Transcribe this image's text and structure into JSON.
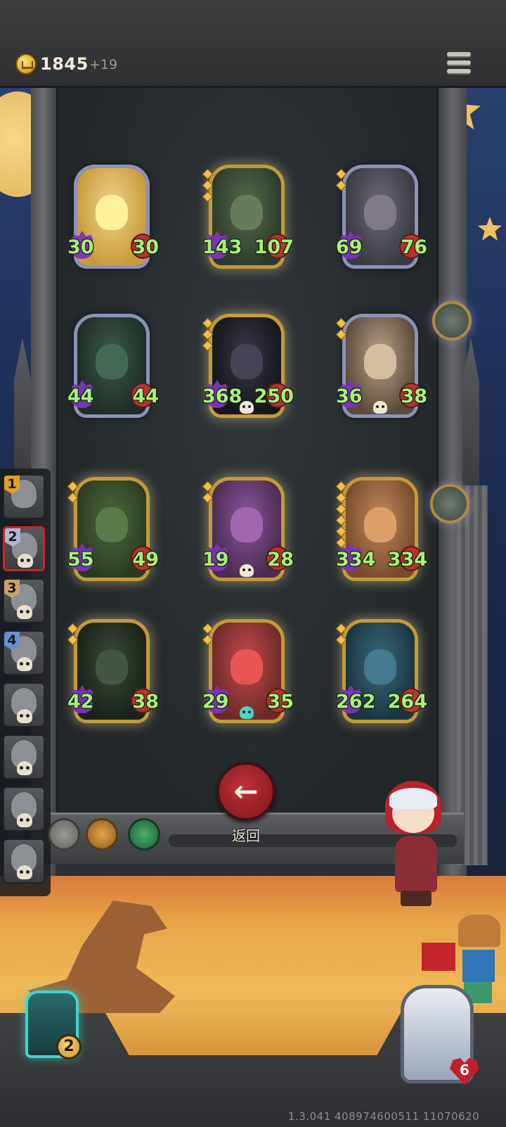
{
  "hud": {
    "gold_amount": "1845",
    "gold_gain": "+19",
    "coin_icon": "crown-coin-icon",
    "menu_icon": "hamburger-menu-icon"
  },
  "cards": [
    {
      "attack": "30",
      "health": "30",
      "frame": "silver"
    },
    {
      "attack": "143",
      "health": "107",
      "frame": "gold"
    },
    {
      "attack": "69",
      "health": "76",
      "frame": "silver"
    },
    {
      "attack": "44",
      "health": "44",
      "frame": "silver"
    },
    {
      "attack": "368",
      "health": "250",
      "frame": "gold"
    },
    {
      "attack": "36",
      "health": "38",
      "frame": "silver"
    },
    {
      "attack": "55",
      "health": "49",
      "frame": "gold"
    },
    {
      "attack": "19",
      "health": "28",
      "frame": "gold"
    },
    {
      "attack": "334",
      "health": "334",
      "frame": "gold"
    },
    {
      "attack": "42",
      "health": "38",
      "frame": "gold"
    },
    {
      "attack": "29",
      "health": "35",
      "frame": "gold"
    },
    {
      "attack": "262",
      "health": "264",
      "frame": "gold"
    }
  ],
  "roster": {
    "slots": [
      {
        "number": "1",
        "badge_color": "#e0a02a"
      },
      {
        "number": "2",
        "badge_color": "#a9b8d8"
      },
      {
        "number": "3",
        "badge_color": "#c8a26a"
      },
      {
        "number": "4",
        "badge_color": "#6a8fd0"
      },
      {
        "number": ""
      },
      {
        "number": ""
      },
      {
        "number": ""
      },
      {
        "number": ""
      }
    ],
    "active_index": 1
  },
  "back_button": {
    "label": "返回",
    "icon": "arrow-left-icon"
  },
  "deck": {
    "count": "2"
  },
  "hero": {
    "lives": "6"
  },
  "version": "1.3.041 408974600511 11070620",
  "colors": {
    "stat_green": "#a7f07a",
    "gold_frame": "#c39a3b",
    "silver_frame": "#8a92b8",
    "active_slot": "#c9252a",
    "back_button": "#b02a31"
  }
}
